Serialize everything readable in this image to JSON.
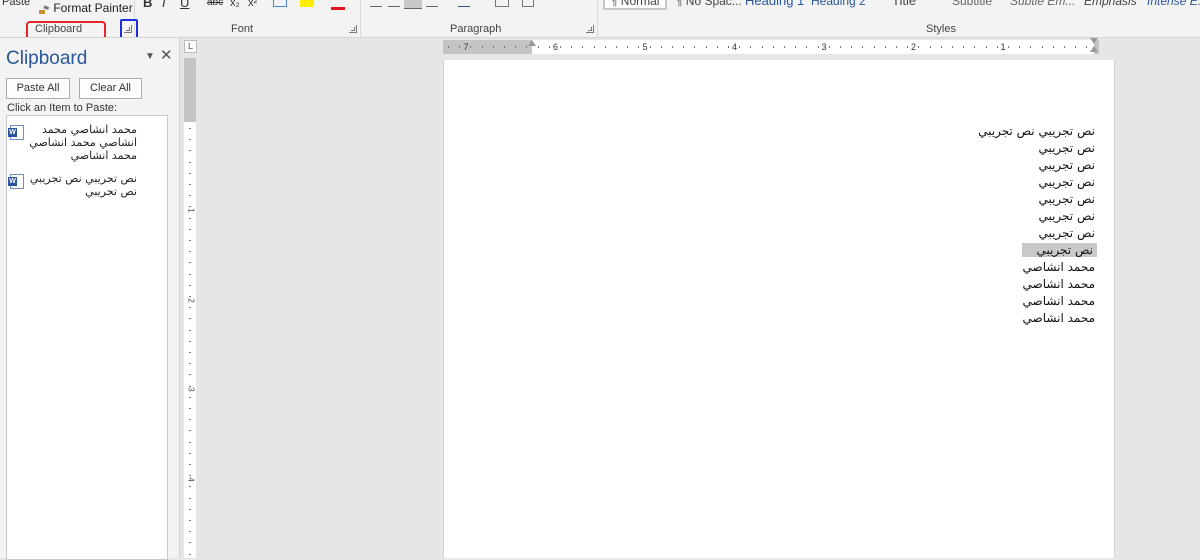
{
  "ribbon": {
    "paste_label": "Paste",
    "format_painter_label": "Format Painter",
    "groups": {
      "clipboard": "Clipboard",
      "font": "Font",
      "paragraph": "Paragraph",
      "styles": "Styles"
    },
    "font_buttons": [
      "B",
      "I",
      "U",
      "abc",
      "x₂",
      "x²"
    ],
    "styles": [
      "¶ Normal",
      "¶ No Spac...",
      "Heading 1",
      "Heading 2",
      "Title",
      "Subtitle",
      "Subtle Em...",
      "Emphasis",
      "Intense E..."
    ]
  },
  "clipboard_pane": {
    "title": "Clipboard",
    "paste_all": "Paste All",
    "clear_all": "Clear All",
    "hint": "Click an Item to Paste:",
    "items": [
      {
        "text": "محمد انشاصي محمد انشاصي محمد انشاصي محمد انشاصي"
      },
      {
        "text": "نص تجريبي نص تجريبي نص تجريبي"
      }
    ]
  },
  "rulers": {
    "horizontal_numbers": [
      "7",
      "6",
      "5",
      "4",
      "3",
      "2",
      "1"
    ],
    "vertical_numbers": [
      "1",
      "2",
      "3",
      "4"
    ],
    "tab_selector": "L"
  },
  "document": {
    "lines": [
      "نص تجريبي نص تجريبي",
      "نص تجريبي",
      "نص تجريبي",
      "نص تجريبي",
      "نص تجريبي",
      "نص تجريبي",
      "نص تجريبي",
      "نص تجريبي",
      "محمد انشاصي",
      "محمد انشاصي",
      "محمد انشاصي",
      "محمد انشاصي"
    ],
    "selected_line_index": 7
  },
  "colors": {
    "accent": "#2b579a",
    "annotation_red": "#e8242b",
    "annotation_blue": "#1b2fd6",
    "selection": "#c9c9c9"
  }
}
